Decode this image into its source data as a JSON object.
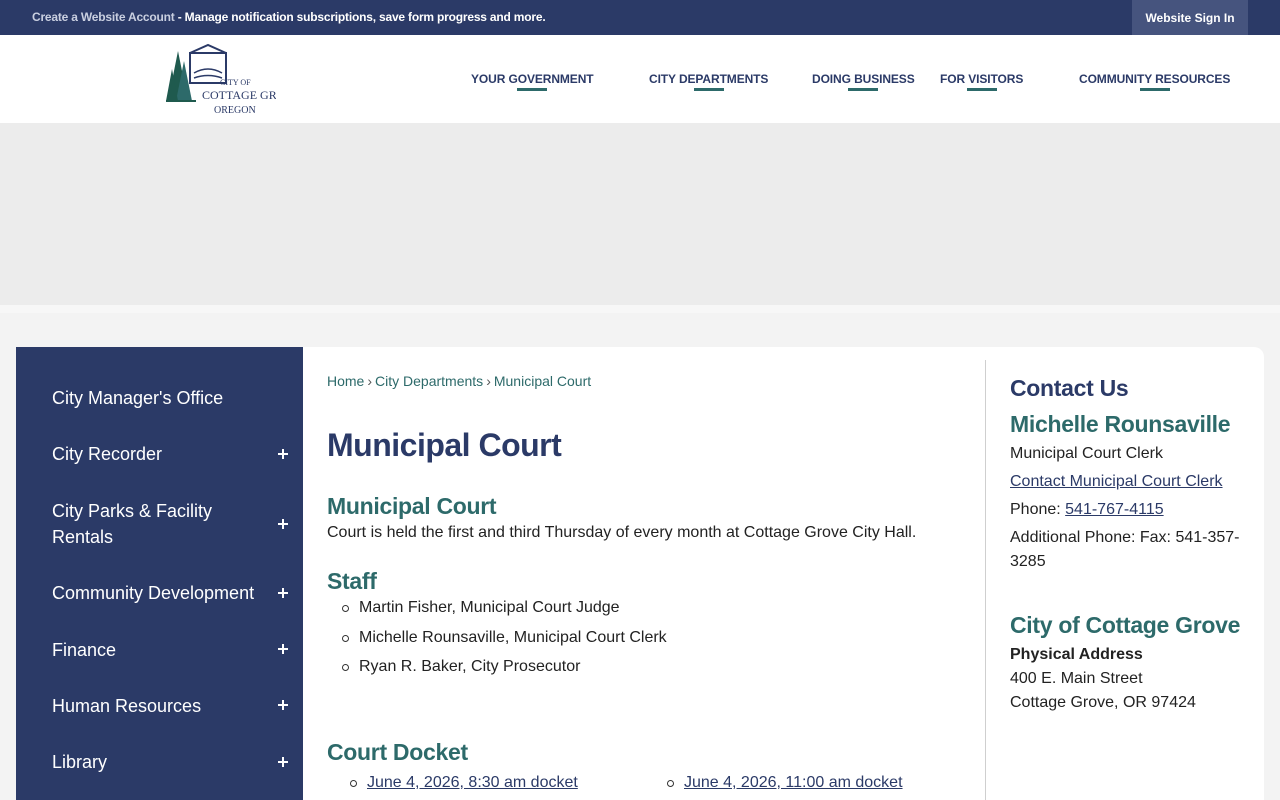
{
  "topbar": {
    "create_account": "Create a Website Account",
    "message": " - Manage notification subscriptions, save form progress and more.",
    "sign_in": "Website Sign In"
  },
  "logo": {
    "line1": "CITY OF",
    "line2": "COTTAGE GROVE",
    "line3": "OREGON"
  },
  "nav": {
    "items": [
      {
        "label": "YOUR GOVERNMENT"
      },
      {
        "label": "CITY DEPARTMENTS"
      },
      {
        "label": "DOING BUSINESS"
      },
      {
        "label": "FOR VISITORS"
      },
      {
        "label": "COMMUNITY RESOURCES"
      }
    ]
  },
  "sidebar": {
    "items": [
      {
        "label": "City Manager's Office",
        "expandable": false
      },
      {
        "label": "City Recorder",
        "expandable": true
      },
      {
        "label": "City Parks & Facility Rentals",
        "expandable": true
      },
      {
        "label": "Community Development",
        "expandable": true
      },
      {
        "label": "Finance",
        "expandable": true
      },
      {
        "label": "Human Resources",
        "expandable": true
      },
      {
        "label": "Library",
        "expandable": true
      }
    ]
  },
  "breadcrumb": {
    "home": "Home",
    "sep": "›",
    "section": "City Departments",
    "current": "Municipal Court"
  },
  "main": {
    "page_title": "Municipal Court",
    "court_heading": "Municipal Court",
    "court_text": "Court is held the first and third Thursday of every month at Cottage Grove City Hall.",
    "staff_heading": "Staff",
    "staff": [
      "Martin Fisher, Municipal Court Judge",
      "Michelle Rounsaville, Municipal Court Clerk",
      "Ryan R. Baker, City Prosecutor"
    ],
    "docket_heading": "Court Docket",
    "dockets": [
      "June 4, 2026, 8:30 am docket",
      "June 4, 2026, 11:00 am docket"
    ]
  },
  "contact": {
    "heading": "Contact Us",
    "name": "Michelle Rounsaville",
    "title": "Municipal Court Clerk",
    "contact_link": "Contact Municipal Court Clerk",
    "phone_label": "Phone: ",
    "phone": "541-767-4115",
    "additional_phone": "Additional Phone: Fax: 541-357-3285",
    "org_heading": "City of Cottage Grove",
    "address_label": "Physical Address",
    "street": "400 E. Main Street",
    "city": "Cottage Grove, OR 97424"
  },
  "colors": {
    "navy": "#2b3a67",
    "teal": "#2d6a6a"
  }
}
